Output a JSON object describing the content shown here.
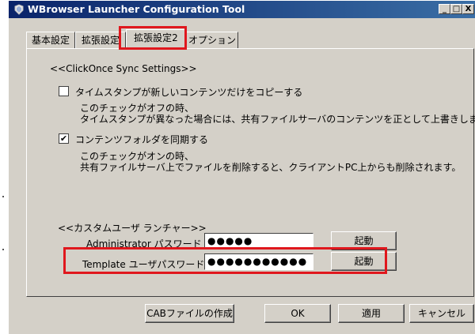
{
  "window": {
    "title": "WBrowser Launcher Configuration Tool",
    "controls": [
      "_",
      "□",
      "X"
    ]
  },
  "tabs": [
    {
      "label": "基本設定"
    },
    {
      "label": "拡張設定"
    },
    {
      "label": "拡張設定2",
      "active": true
    },
    {
      "label": "オプション"
    }
  ],
  "clickonce": {
    "section_label": "<<ClickOnce Sync Settings>>",
    "copy_newer": {
      "checked": false,
      "label": "タイムスタンプが新しいコンテンツだけをコピーする",
      "desc1": "このチェックがオフの時、",
      "desc2": "タイムスタンプが異なった場合には、共有ファイルサーバのコンテンツを正として上書きします。"
    },
    "sync_folder": {
      "checked": true,
      "check_mark": "✔",
      "label": "コンテンツフォルダを同期する",
      "desc1": "このチェックがオンの時、",
      "desc2": "共有ファイルサーバ上でファイルを削除すると、クライアントPC上からも削除されます。"
    }
  },
  "custom_user": {
    "section_label": "<<カスタムユーザ ランチャー>>",
    "admin_label": "Administrator パスワード",
    "admin_value": "●●●●●",
    "admin_launch": "起動",
    "template_label": "Template ユーザパスワード",
    "template_value": "●●●●●●●●●●●",
    "template_launch": "起動"
  },
  "footer": {
    "cab_button": "CABファイルの作成",
    "ok_button": "OK",
    "apply_button": "適用",
    "cancel_button": "キャンセル"
  },
  "colors": {
    "highlight": "#e0171d",
    "title_bar_start": "#0a246a",
    "title_bar_end": "#3a6ea5"
  }
}
